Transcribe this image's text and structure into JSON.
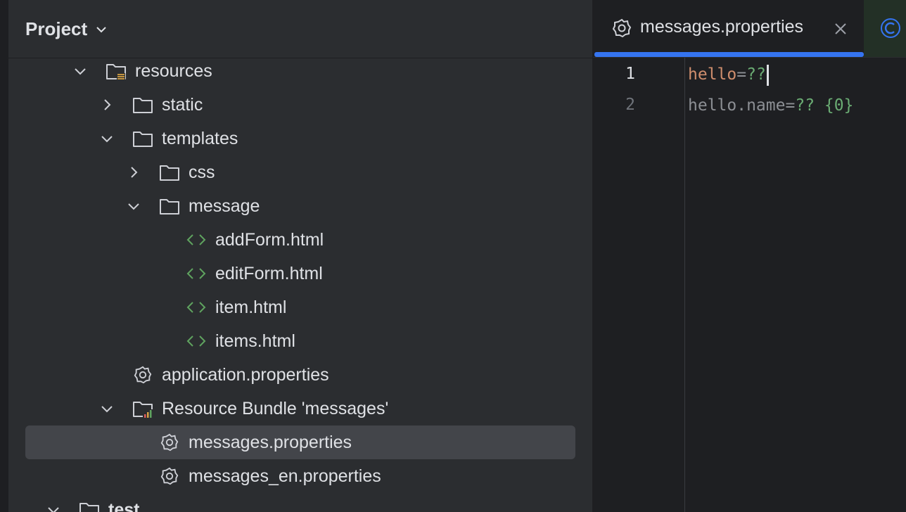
{
  "project": {
    "title": "Project",
    "tree": [
      {
        "label": "resources",
        "icon": "resources-folder-icon",
        "arrow": "down",
        "selected": false
      },
      {
        "label": "static",
        "icon": "folder-icon",
        "arrow": "right",
        "selected": false
      },
      {
        "label": "templates",
        "icon": "folder-icon",
        "arrow": "down",
        "selected": false
      },
      {
        "label": "css",
        "icon": "folder-icon",
        "arrow": "right",
        "selected": false
      },
      {
        "label": "message",
        "icon": "folder-icon",
        "arrow": "down",
        "selected": false
      },
      {
        "label": "addForm.html",
        "icon": "html-icon",
        "arrow": "",
        "selected": false
      },
      {
        "label": "editForm.html",
        "icon": "html-icon",
        "arrow": "",
        "selected": false
      },
      {
        "label": "item.html",
        "icon": "html-icon",
        "arrow": "",
        "selected": false
      },
      {
        "label": "items.html",
        "icon": "html-icon",
        "arrow": "",
        "selected": false
      },
      {
        "label": "application.properties",
        "icon": "gear-icon",
        "arrow": "",
        "selected": false
      },
      {
        "label": "Resource Bundle 'messages'",
        "icon": "resource-bundle-icon",
        "arrow": "down",
        "selected": false
      },
      {
        "label": "messages.properties",
        "icon": "gear-icon",
        "arrow": "",
        "selected": true
      },
      {
        "label": "messages_en.properties",
        "icon": "gear-icon",
        "arrow": "",
        "selected": false
      },
      {
        "label": "test",
        "icon": "folder-icon",
        "arrow": "down",
        "selected": false
      }
    ]
  },
  "editor": {
    "active_tab": "messages.properties",
    "lines": [
      {
        "number": "1",
        "key": "hello",
        "eq": "=",
        "value": "??",
        "arg": ""
      },
      {
        "number": "2",
        "key": "hello.name",
        "eq": "=",
        "value": "?? ",
        "arg": "{0}"
      }
    ]
  },
  "colors": {
    "accent": "#3574f0",
    "html_icon": "#5fa35f",
    "key_active": "#cf8e6d",
    "value": "#6aab73"
  }
}
